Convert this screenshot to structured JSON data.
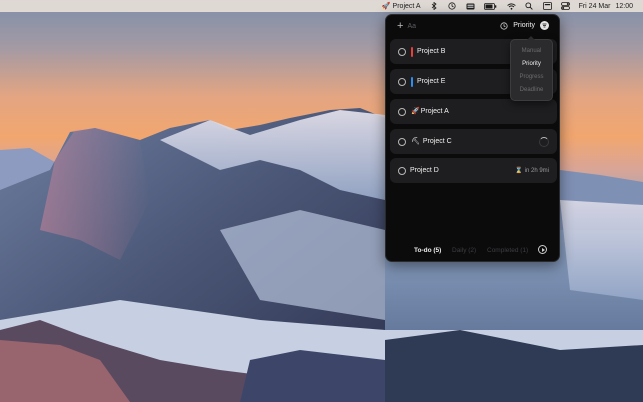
{
  "menubar": {
    "app_emoji": "🚀",
    "app_label": "Project A",
    "battery_icon": "battery-icon",
    "date": "Fri 24 Mar",
    "time": "12:00"
  },
  "panel": {
    "add_placeholder": "Aa",
    "sort_label": "Priority",
    "sort_menu": [
      "Manual",
      "Priority",
      "Progress",
      "Deadline"
    ],
    "sort_active_index": 1,
    "tasks": [
      {
        "title": "Project B",
        "color": "#e5403a"
      },
      {
        "title": "Project E",
        "color": "#2f8df0"
      },
      {
        "title": "Project A",
        "emoji": "🚀"
      },
      {
        "title": "Project C",
        "emoji": "⛏",
        "status": "spinner"
      },
      {
        "title": "Project D",
        "meta": "in 2h 9mi"
      }
    ],
    "tabs": {
      "todo": "To-do (5)",
      "daily": "Daily (2)",
      "completed": "Completed (1)"
    }
  },
  "colors": {
    "panel_bg": "#0b0b0c",
    "row_bg": "#1e1e20"
  }
}
